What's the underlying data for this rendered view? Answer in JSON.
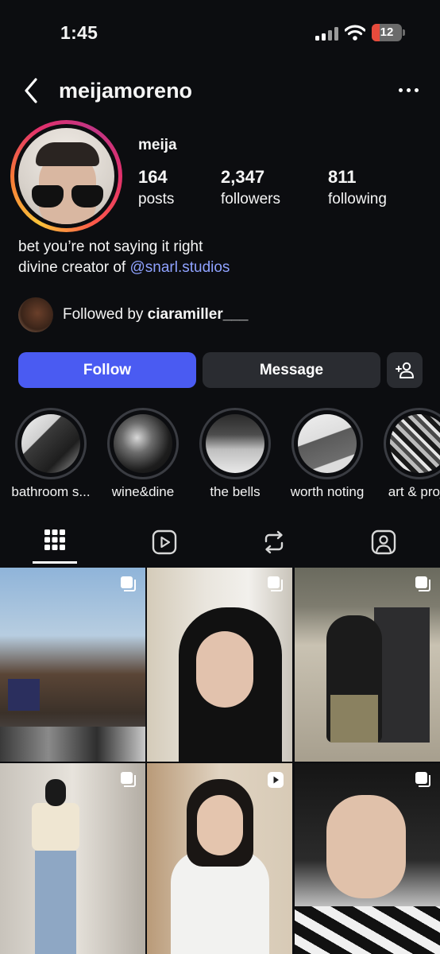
{
  "status_bar": {
    "time": "1:45",
    "battery_level": "12",
    "battery_fraction": 0.12
  },
  "header": {
    "username": "meijamoreno"
  },
  "profile": {
    "display_name": "meija",
    "stats": [
      {
        "value": "164",
        "label": "posts"
      },
      {
        "value": "2,347",
        "label": "followers"
      },
      {
        "value": "811",
        "label": "following"
      }
    ],
    "bio_line1": "bet you’re not saying it right",
    "bio_line2_prefix": "divine creator of ",
    "bio_mention": "@snarl.studios",
    "followed_by_prefix": "Followed by ",
    "followed_by_user": "ciaramiller___"
  },
  "actions": {
    "follow_label": "Follow",
    "message_label": "Message"
  },
  "highlights": [
    {
      "label": "bathroom s..."
    },
    {
      "label": "wine&dine"
    },
    {
      "label": "the bells"
    },
    {
      "label": "worth noting"
    },
    {
      "label": "art & proje"
    }
  ],
  "tabs": [
    {
      "icon": "grid-icon",
      "selected": true
    },
    {
      "icon": "reels-icon",
      "selected": false
    },
    {
      "icon": "reposts-icon",
      "selected": false
    },
    {
      "icon": "tagged-icon",
      "selected": false
    }
  ],
  "posts": [
    {
      "type": "carousel"
    },
    {
      "type": "carousel"
    },
    {
      "type": "carousel"
    },
    {
      "type": "carousel"
    },
    {
      "type": "reel"
    },
    {
      "type": "carousel"
    }
  ],
  "colors": {
    "accent": "#4a5bf2",
    "mention": "#8fa2ff",
    "background": "#0c0d10",
    "button": "#2a2c31"
  }
}
